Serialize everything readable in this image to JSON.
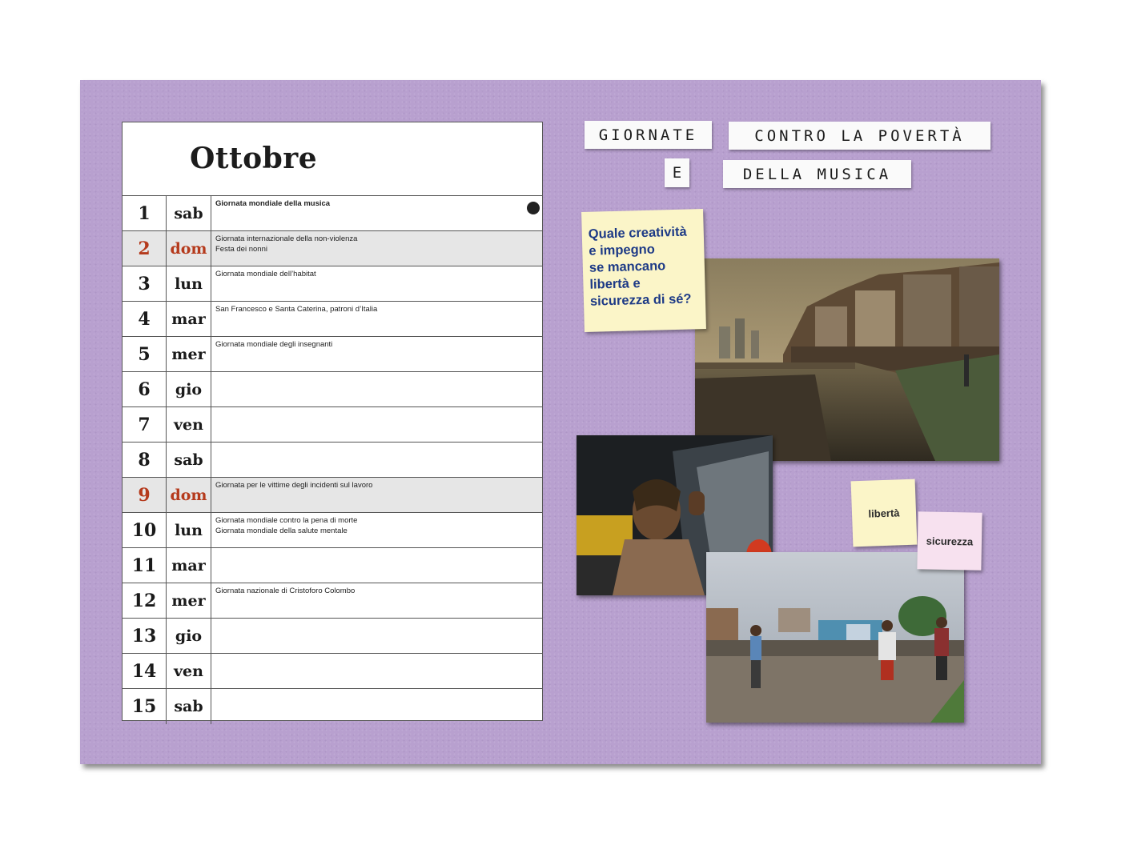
{
  "calendar": {
    "month": "Ottobre",
    "rows": [
      {
        "num": "1",
        "day": "sab",
        "sunday": false,
        "events": [
          "Giornata mondiale della musica"
        ],
        "bold": true,
        "dot": true
      },
      {
        "num": "2",
        "day": "dom",
        "sunday": true,
        "events": [
          "Giornata internazionale della non-violenza",
          "Festa dei nonni"
        ]
      },
      {
        "num": "3",
        "day": "lun",
        "sunday": false,
        "events": [
          "Giornata mondiale dell’habitat"
        ]
      },
      {
        "num": "4",
        "day": "mar",
        "sunday": false,
        "events": [
          "San Francesco e Santa Caterina, patroni d’Italia"
        ]
      },
      {
        "num": "5",
        "day": "mer",
        "sunday": false,
        "events": [
          "Giornata mondiale degli insegnanti"
        ]
      },
      {
        "num": "6",
        "day": "gio",
        "sunday": false,
        "events": []
      },
      {
        "num": "7",
        "day": "ven",
        "sunday": false,
        "events": []
      },
      {
        "num": "8",
        "day": "sab",
        "sunday": false,
        "events": []
      },
      {
        "num": "9",
        "day": "dom",
        "sunday": true,
        "events": [
          "Giornata per le vittime degli incidenti sul lavoro"
        ]
      },
      {
        "num": "10",
        "day": "lun",
        "sunday": false,
        "events": [
          "Giornata mondiale contro la pena di morte",
          "Giornata mondiale della salute mentale"
        ]
      },
      {
        "num": "11",
        "day": "mar",
        "sunday": false,
        "events": []
      },
      {
        "num": "12",
        "day": "mer",
        "sunday": false,
        "events": [
          "Giornata nazionale di Cristoforo Colombo"
        ]
      },
      {
        "num": "13",
        "day": "gio",
        "sunday": false,
        "events": []
      },
      {
        "num": "14",
        "day": "ven",
        "sunday": false,
        "events": []
      },
      {
        "num": "15",
        "day": "sab",
        "sunday": false,
        "events": []
      }
    ]
  },
  "title": {
    "word1": "GIORNATE",
    "word2": "CONTRO LA POVERTÀ",
    "word3": "E",
    "word4": "DELLA MUSICA"
  },
  "notes": {
    "question": [
      "Quale creatività",
      "e impegno",
      "se mancano",
      "libertà e",
      "sicurezza di sé?"
    ],
    "liberta": "libertà",
    "sicurezza": "sicurezza"
  },
  "colors": {
    "board": "#b8a0cf",
    "sunday": "#b53a1c",
    "question_text": "#1d3a86"
  }
}
